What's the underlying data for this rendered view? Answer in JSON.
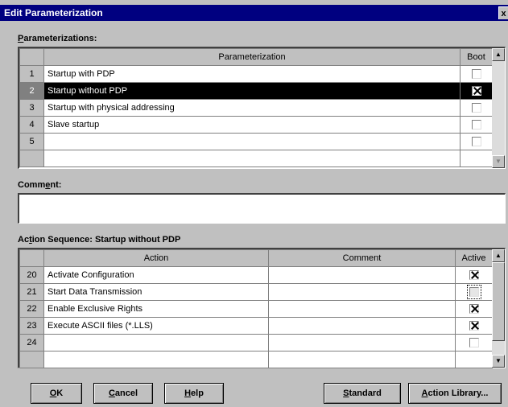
{
  "window": {
    "title": "Edit Parameterization",
    "close_glyph": "x"
  },
  "params": {
    "label_key": "P",
    "label_rest": "arameterizations:",
    "col_name": "Parameterization",
    "col_boot": "Boot",
    "rows": [
      {
        "num": "1",
        "name": "Startup with PDP",
        "boot": false
      },
      {
        "num": "2",
        "name": "Startup without PDP",
        "boot": true,
        "selected": true
      },
      {
        "num": "3",
        "name": "Startup with physical addressing",
        "boot": false
      },
      {
        "num": "4",
        "name": "Slave startup",
        "boot": false
      },
      {
        "num": "5",
        "name": "",
        "boot": false
      }
    ]
  },
  "comment": {
    "label_pre": "Comm",
    "label_key": "e",
    "label_post": "nt:",
    "value": ""
  },
  "actions": {
    "label_pre": "Ac",
    "label_key": "t",
    "label_post": "ion Sequence:  Startup without PDP",
    "col_action": "Action",
    "col_comment": "Comment",
    "col_active": "Active",
    "rows": [
      {
        "num": "20",
        "action": "Activate Configuration",
        "comment": "",
        "active": true
      },
      {
        "num": "21",
        "action": "Start Data Transmission",
        "comment": "",
        "active": false,
        "focused": true
      },
      {
        "num": "22",
        "action": "Enable Exclusive Rights",
        "comment": "",
        "active": true
      },
      {
        "num": "23",
        "action": "Execute ASCII files (*.LLS)",
        "comment": "",
        "active": true
      },
      {
        "num": "24",
        "action": "",
        "comment": "",
        "active": false
      }
    ]
  },
  "buttons": {
    "ok": {
      "key": "O",
      "rest": "K"
    },
    "cancel": {
      "key": "C",
      "rest": "ancel"
    },
    "help": {
      "key": "H",
      "rest": "elp"
    },
    "standard": {
      "key": "S",
      "rest": "tandard"
    },
    "library": {
      "key": "A",
      "rest": "ction Library..."
    }
  },
  "icons": {
    "scroll_up": "scroll-up-arrow-icon",
    "scroll_down": "scroll-down-arrow-icon"
  }
}
